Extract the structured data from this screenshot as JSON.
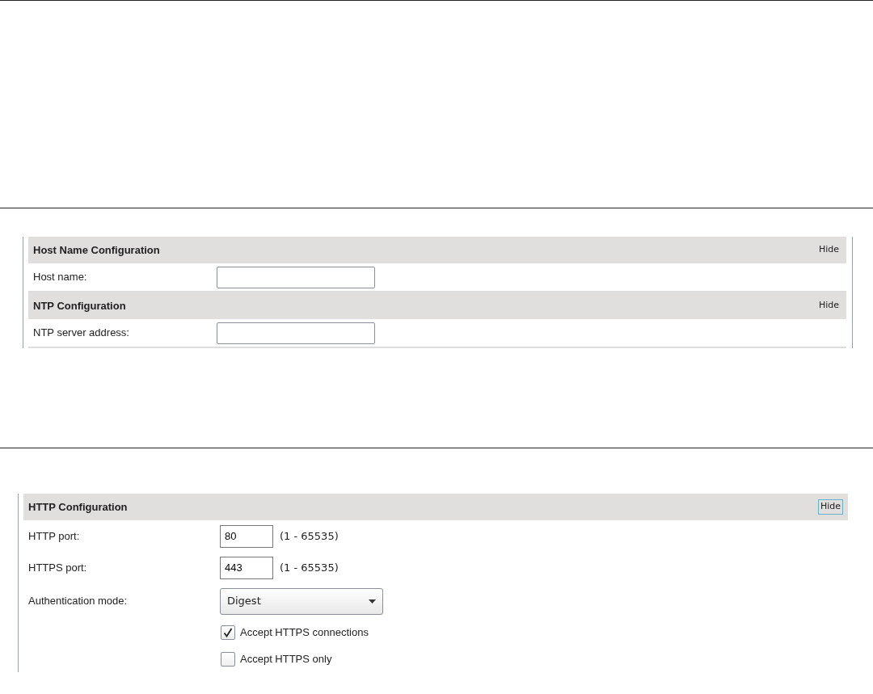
{
  "panels": [
    {
      "sections": [
        {
          "title": "Host Name Configuration",
          "hide": {
            "label": "Hide",
            "focused": false
          },
          "rows": [
            {
              "kind": "text",
              "label": "Host name:",
              "value": ""
            }
          ]
        },
        {
          "title": "NTP Configuration",
          "hide": {
            "label": "Hide",
            "focused": false
          },
          "rows": [
            {
              "kind": "text",
              "label": "NTP server address:",
              "value": ""
            }
          ]
        }
      ]
    },
    {
      "sections": [
        {
          "title": "HTTP Configuration",
          "hide": {
            "label": "Hide",
            "focused": true
          },
          "rows": [
            {
              "kind": "number",
              "label": "HTTP port:",
              "value": "80",
              "hint": "(1 - 65535)"
            },
            {
              "kind": "number",
              "label": "HTTPS port:",
              "value": "443",
              "hint": "(1 - 65535)"
            },
            {
              "kind": "select",
              "label": "Authentication mode:",
              "value": "Digest"
            },
            {
              "kind": "checkbox",
              "label": "Accept HTTPS connections",
              "checked": true
            },
            {
              "kind": "checkbox",
              "label": "Accept HTTPS only",
              "checked": false
            }
          ]
        }
      ]
    }
  ]
}
